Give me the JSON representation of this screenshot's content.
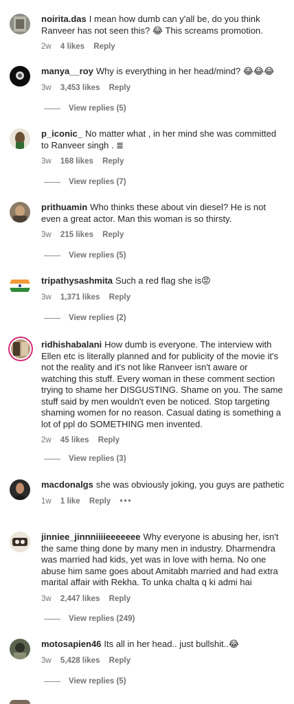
{
  "comments": [
    {
      "username": "noirita.das",
      "text": "I mean how dumb can y'all be, do you think Ranveer has not seen this? 😂 This screams promotion.",
      "time": "2w",
      "likes": "4 likes",
      "reply": "Reply"
    },
    {
      "username": "manya__roy",
      "text": "Why is everything in her head/mind? 😂😂😂",
      "time": "3w",
      "likes": "3,453 likes",
      "reply": "Reply",
      "view_replies": "View replies (5)"
    },
    {
      "username": "p_iconic_",
      "text": "No matter what , in her mind she was committed to Ranveer singh . ≣",
      "time": "3w",
      "likes": "168 likes",
      "reply": "Reply",
      "view_replies": "View replies (7)"
    },
    {
      "username": "prithuamin",
      "text": "Who thinks these about vin diesel? He is not even a great actor. Man this woman is so thirsty.",
      "time": "3w",
      "likes": "215 likes",
      "reply": "Reply",
      "view_replies": "View replies (5)"
    },
    {
      "username": "tripathysashmita",
      "text": "Such a red flag she is😡",
      "time": "3w",
      "likes": "1,371 likes",
      "reply": "Reply",
      "view_replies": "View replies (2)"
    },
    {
      "username": "ridhishabalani",
      "text": "How dumb is everyone. The interview with Ellen etc is literally planned and for publicity of the movie it's not the reality and it's not like Ranveer isn't aware or watching this stuff. Every woman in these comment section trying to shame her DISGUSTING. Shame on you. The same stuff said by men wouldn't even be noticed. Stop targeting shaming women for no reason. Casual dating is something a lot of ppl do SOMETHING men invented.",
      "time": "2w",
      "likes": "45 likes",
      "reply": "Reply",
      "view_replies": "View replies (3)"
    },
    {
      "username": "macdonalgs",
      "text": "she was obviously joking, you guys are pathetic",
      "time": "1w",
      "likes": "1 like",
      "reply": "Reply",
      "more": "•••"
    },
    {
      "username": "jinniee_jinnniiiieeeeeee",
      "text": "Why everyone is abusing her, isn't the same thing done by many men in industry. Dharmendra was married had kids, yet was in love with hema. No one abuse him same goes about Amitabh married and had extra marital affair with Rekha. To unka chalta q ki admi hai",
      "time": "3w",
      "likes": "2,447 likes",
      "reply": "Reply",
      "view_replies": "View replies (249)"
    },
    {
      "username": "motosapien46",
      "text": "Its all in her head.. just bullshit..😂",
      "time": "3w",
      "likes": "5,428 likes",
      "reply": "Reply",
      "view_replies": "View replies (5)"
    }
  ]
}
